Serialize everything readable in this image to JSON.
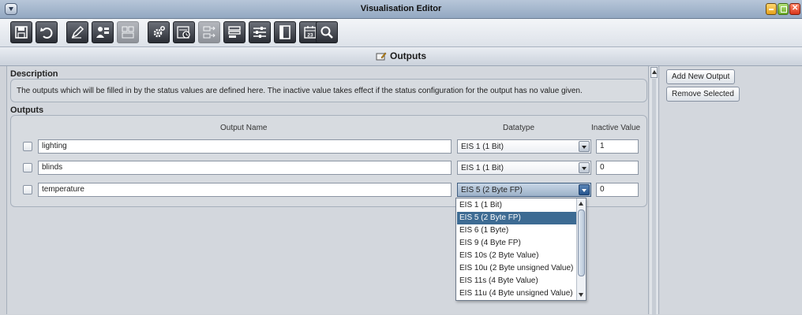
{
  "window": {
    "title": "Visualisation Editor"
  },
  "toolbar": {
    "buttons": [
      {
        "icon": "save-icon"
      },
      {
        "icon": "undo-icon"
      },
      {
        "icon": "edit-pen-icon"
      },
      {
        "icon": "users-icon"
      },
      {
        "icon": "grid-layout-icon",
        "disabled": true
      },
      {
        "icon": "settings-gear-icon"
      },
      {
        "icon": "schedule-clock-icon"
      },
      {
        "icon": "export-icon",
        "disabled": true
      },
      {
        "icon": "list-bars-icon"
      },
      {
        "icon": "sliders-icon"
      },
      {
        "icon": "page-icon"
      },
      {
        "icon": "calendar-icon",
        "calendar_day": "23"
      },
      {
        "icon": "search-icon"
      }
    ]
  },
  "header": {
    "title": "Outputs",
    "icon": "outputs-edit-icon"
  },
  "description": {
    "section_title": "Description",
    "text": "The outputs which will be filled in by the status values are defined here. The inactive value takes effect if the status configuration for the output has no value given."
  },
  "outputs": {
    "section_title": "Outputs",
    "columns": {
      "name": "Output Name",
      "datatype": "Datatype",
      "inactive": "Inactive Value"
    },
    "rows": [
      {
        "name": "lighting",
        "datatype": "EIS 1 (1 Bit)",
        "inactive": "1",
        "checked": false
      },
      {
        "name": "blinds",
        "datatype": "EIS 1 (1 Bit)",
        "inactive": "0",
        "checked": false
      },
      {
        "name": "temperature",
        "datatype": "EIS 5 (2 Byte FP)",
        "inactive": "0",
        "checked": false,
        "dropdown_open": true
      }
    ]
  },
  "datatype_dropdown": {
    "selected": "EIS 5 (2 Byte FP)",
    "options": [
      "EIS 1 (1 Bit)",
      "EIS 5 (2 Byte FP)",
      "EIS 6 (1 Byte)",
      "EIS 9 (4 Byte FP)",
      "EIS 10s (2 Byte Value)",
      "EIS 10u (2 Byte unsigned Value)",
      "EIS 11s (4 Byte Value)",
      "EIS 11u (4 Byte unsigned Value)"
    ]
  },
  "sidebar": {
    "add_label": "Add New Output",
    "remove_label": "Remove Selected"
  },
  "colors": {
    "selection": "#3d6b93",
    "panel_bg": "#d3d7dd"
  }
}
